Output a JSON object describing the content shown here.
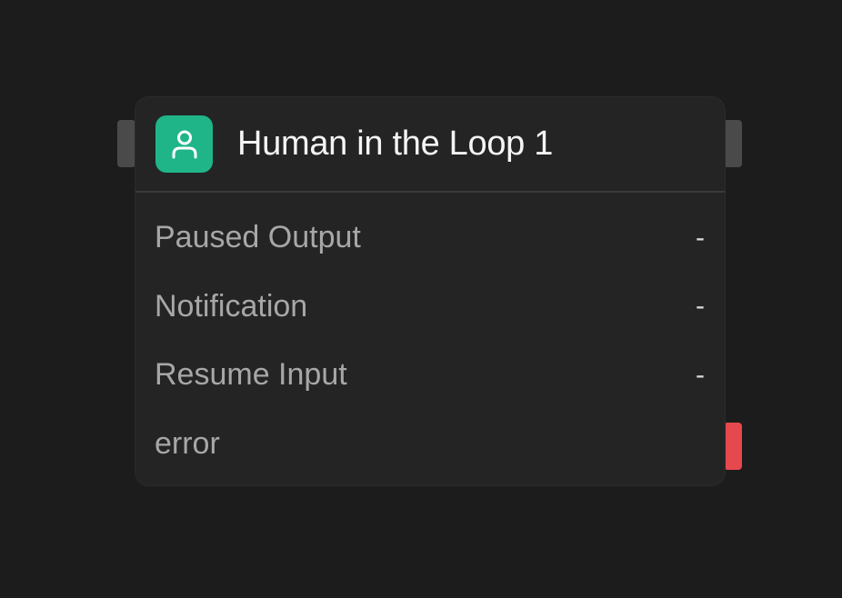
{
  "node": {
    "title": "Human in the Loop 1",
    "icon": "person-icon",
    "icon_color": "#1fb589",
    "error_handle_color": "#e5484d",
    "outputs": [
      {
        "label": "Paused Output",
        "value": "-"
      },
      {
        "label": "Notification",
        "value": "-"
      },
      {
        "label": "Resume Input",
        "value": "-"
      },
      {
        "label": "error",
        "value": ""
      }
    ]
  }
}
